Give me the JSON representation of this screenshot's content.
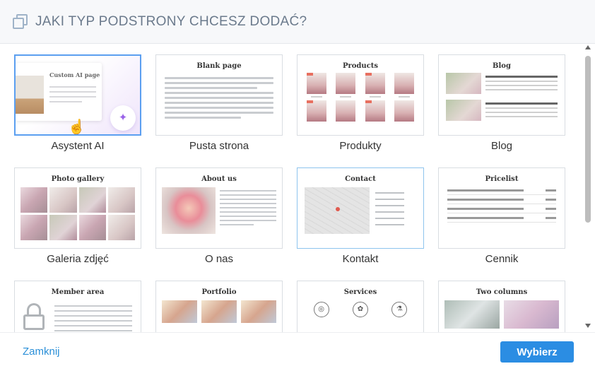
{
  "header": {
    "title": "JAKI TYP PODSTRONY CHCESZ DODAĆ?",
    "icon": "pages-copy-icon"
  },
  "cards": [
    {
      "label": "Asystent AI",
      "thumb_title": "Custom AI page",
      "selected": true
    },
    {
      "label": "Pusta strona",
      "thumb_title": "Blank page"
    },
    {
      "label": "Produkty",
      "thumb_title": "Products"
    },
    {
      "label": "Blog",
      "thumb_title": "Blog"
    },
    {
      "label": "Galeria zdjęć",
      "thumb_title": "Photo gallery"
    },
    {
      "label": "O nas",
      "thumb_title": "About us"
    },
    {
      "label": "Kontakt",
      "thumb_title": "Contact",
      "highlight": true
    },
    {
      "label": "Cennik",
      "thumb_title": "Pricelist"
    },
    {
      "label": "",
      "thumb_title": "Member area"
    },
    {
      "label": "",
      "thumb_title": "Portfolio"
    },
    {
      "label": "",
      "thumb_title": "Services"
    },
    {
      "label": "",
      "thumb_title": "Two columns"
    }
  ],
  "footer": {
    "close_label": "Zamknij",
    "select_label": "Wybierz"
  },
  "colors": {
    "accent": "#2b8de3",
    "link": "#2a8fd8",
    "selected_border": "#5b9ff0",
    "header_bg": "#f7f8fa"
  }
}
